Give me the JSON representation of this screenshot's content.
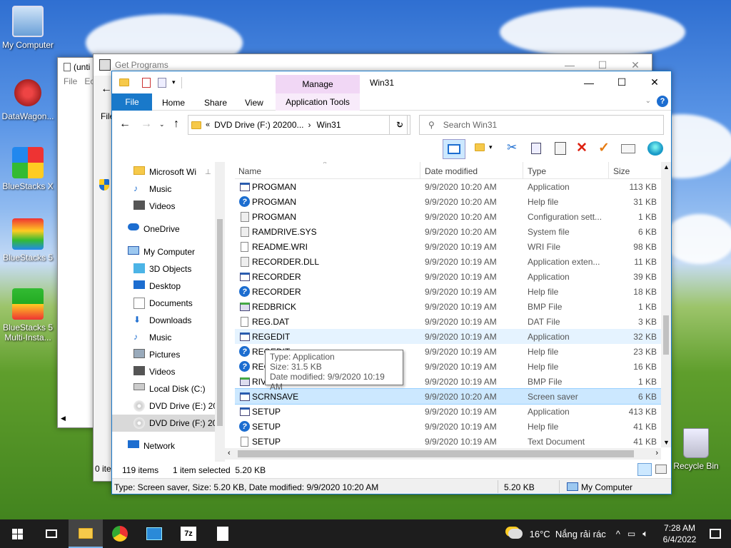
{
  "desktop": {
    "icons": [
      "My Computer",
      "DataWagon...",
      "BlueStacks X",
      "BlueStacks 5",
      "BlueStacks 5 Multi-Insta..."
    ],
    "recycle_bin": "Recycle Bin"
  },
  "bg_windows": {
    "notepad_title": "(unti",
    "notepad_menu": [
      "File",
      "Ec"
    ],
    "getprograms_title": "Get Programs",
    "getprograms_file": "File",
    "getprograms_status": "0 ite"
  },
  "explorer": {
    "title": "Win31",
    "ribbon_context": "Manage",
    "tabs": [
      "File",
      "Home",
      "Share",
      "View",
      "Application Tools"
    ],
    "address": [
      "DVD Drive (F:) 20200...",
      "Win31"
    ],
    "search_placeholder": "Search Win31",
    "columns": [
      "Name",
      "Date modified",
      "Type",
      "Size"
    ],
    "nav": [
      {
        "label": "Microsoft Wi",
        "icon": "folder-icon"
      },
      {
        "label": "Music",
        "icon": "music-icon"
      },
      {
        "label": "Videos",
        "icon": "videos-icon"
      },
      {
        "label": "OneDrive",
        "icon": "cloud-icon"
      },
      {
        "label": "My Computer",
        "icon": "computer-icon"
      },
      {
        "label": "3D Objects",
        "icon": "cube-icon"
      },
      {
        "label": "Desktop",
        "icon": "desktop-icon"
      },
      {
        "label": "Documents",
        "icon": "documents-icon"
      },
      {
        "label": "Downloads",
        "icon": "download-icon"
      },
      {
        "label": "Music",
        "icon": "music-icon"
      },
      {
        "label": "Pictures",
        "icon": "pictures-icon"
      },
      {
        "label": "Videos",
        "icon": "videos-icon"
      },
      {
        "label": "Local Disk (C:)",
        "icon": "disk-icon"
      },
      {
        "label": "DVD Drive (E:) 20",
        "icon": "dvd-icon"
      },
      {
        "label": "DVD Drive (F:) 20",
        "icon": "dvd-icon"
      },
      {
        "label": "Network",
        "icon": "network-icon"
      }
    ],
    "files": [
      {
        "name": "PROGMAN",
        "date": "9/9/2020 10:20 AM",
        "type": "Application",
        "size": "113 KB",
        "icon": "app"
      },
      {
        "name": "PROGMAN",
        "date": "9/9/2020 10:20 AM",
        "type": "Help file",
        "size": "31 KB",
        "icon": "help"
      },
      {
        "name": "PROGMAN",
        "date": "9/9/2020 10:20 AM",
        "type": "Configuration sett...",
        "size": "1 KB",
        "icon": "cfg"
      },
      {
        "name": "RAMDRIVE.SYS",
        "date": "9/9/2020 10:20 AM",
        "type": "System file",
        "size": "6 KB",
        "icon": "cfg"
      },
      {
        "name": "README.WRI",
        "date": "9/9/2020 10:19 AM",
        "type": "WRI File",
        "size": "98 KB",
        "icon": "doc"
      },
      {
        "name": "RECORDER.DLL",
        "date": "9/9/2020 10:19 AM",
        "type": "Application exten...",
        "size": "11 KB",
        "icon": "cfg"
      },
      {
        "name": "RECORDER",
        "date": "9/9/2020 10:19 AM",
        "type": "Application",
        "size": "39 KB",
        "icon": "app"
      },
      {
        "name": "RECORDER",
        "date": "9/9/2020 10:19 AM",
        "type": "Help file",
        "size": "18 KB",
        "icon": "help"
      },
      {
        "name": "REDBRICK",
        "date": "9/9/2020 10:19 AM",
        "type": "BMP File",
        "size": "1 KB",
        "icon": "bmp"
      },
      {
        "name": "REG.DAT",
        "date": "9/9/2020 10:19 AM",
        "type": "DAT File",
        "size": "3 KB",
        "icon": "doc"
      },
      {
        "name": "REGEDIT",
        "date": "9/9/2020 10:19 AM",
        "type": "Application",
        "size": "32 KB",
        "icon": "app"
      },
      {
        "name": "REGEDIT",
        "date": "9/9/2020 10:19 AM",
        "type": "Help file",
        "size": "23 KB",
        "icon": "help"
      },
      {
        "name": "REG",
        "date": "9/9/2020 10:19 AM",
        "type": "Help file",
        "size": "16 KB",
        "icon": "help"
      },
      {
        "name": "RIV",
        "date": "9/9/2020 10:19 AM",
        "type": "BMP File",
        "size": "1 KB",
        "icon": "bmp"
      },
      {
        "name": "SCRNSAVE",
        "date": "9/9/2020 10:20 AM",
        "type": "Screen saver",
        "size": "6 KB",
        "icon": "app"
      },
      {
        "name": "SETUP",
        "date": "9/9/2020 10:19 AM",
        "type": "Application",
        "size": "413 KB",
        "icon": "app"
      },
      {
        "name": "SETUP",
        "date": "9/9/2020 10:19 AM",
        "type": "Help file",
        "size": "41 KB",
        "icon": "help"
      },
      {
        "name": "SETUP",
        "date": "9/9/2020 10:19 AM",
        "type": "Text Document",
        "size": "41 KB",
        "icon": "doc"
      }
    ],
    "tooltip": [
      "Type: Application",
      "Size: 31.5 KB",
      "Date modified: 9/9/2020 10:19 AM"
    ],
    "status_count": "119 items",
    "status_selected": "1 item selected  5.20 KB",
    "details_bar": "Type: Screen saver, Size: 5.20 KB, Date modified: 9/9/2020 10:20 AM",
    "details_size": "5.20 KB",
    "details_location": "My Computer"
  },
  "taskbar": {
    "weather": "16°C  Nắng rải rác",
    "time": "7:28 AM",
    "date": "6/4/2022"
  },
  "colors": {
    "accent": "#1979ca",
    "selected": "#cce8ff",
    "hover": "#e5f3ff",
    "manage": "#f1d7f5"
  }
}
